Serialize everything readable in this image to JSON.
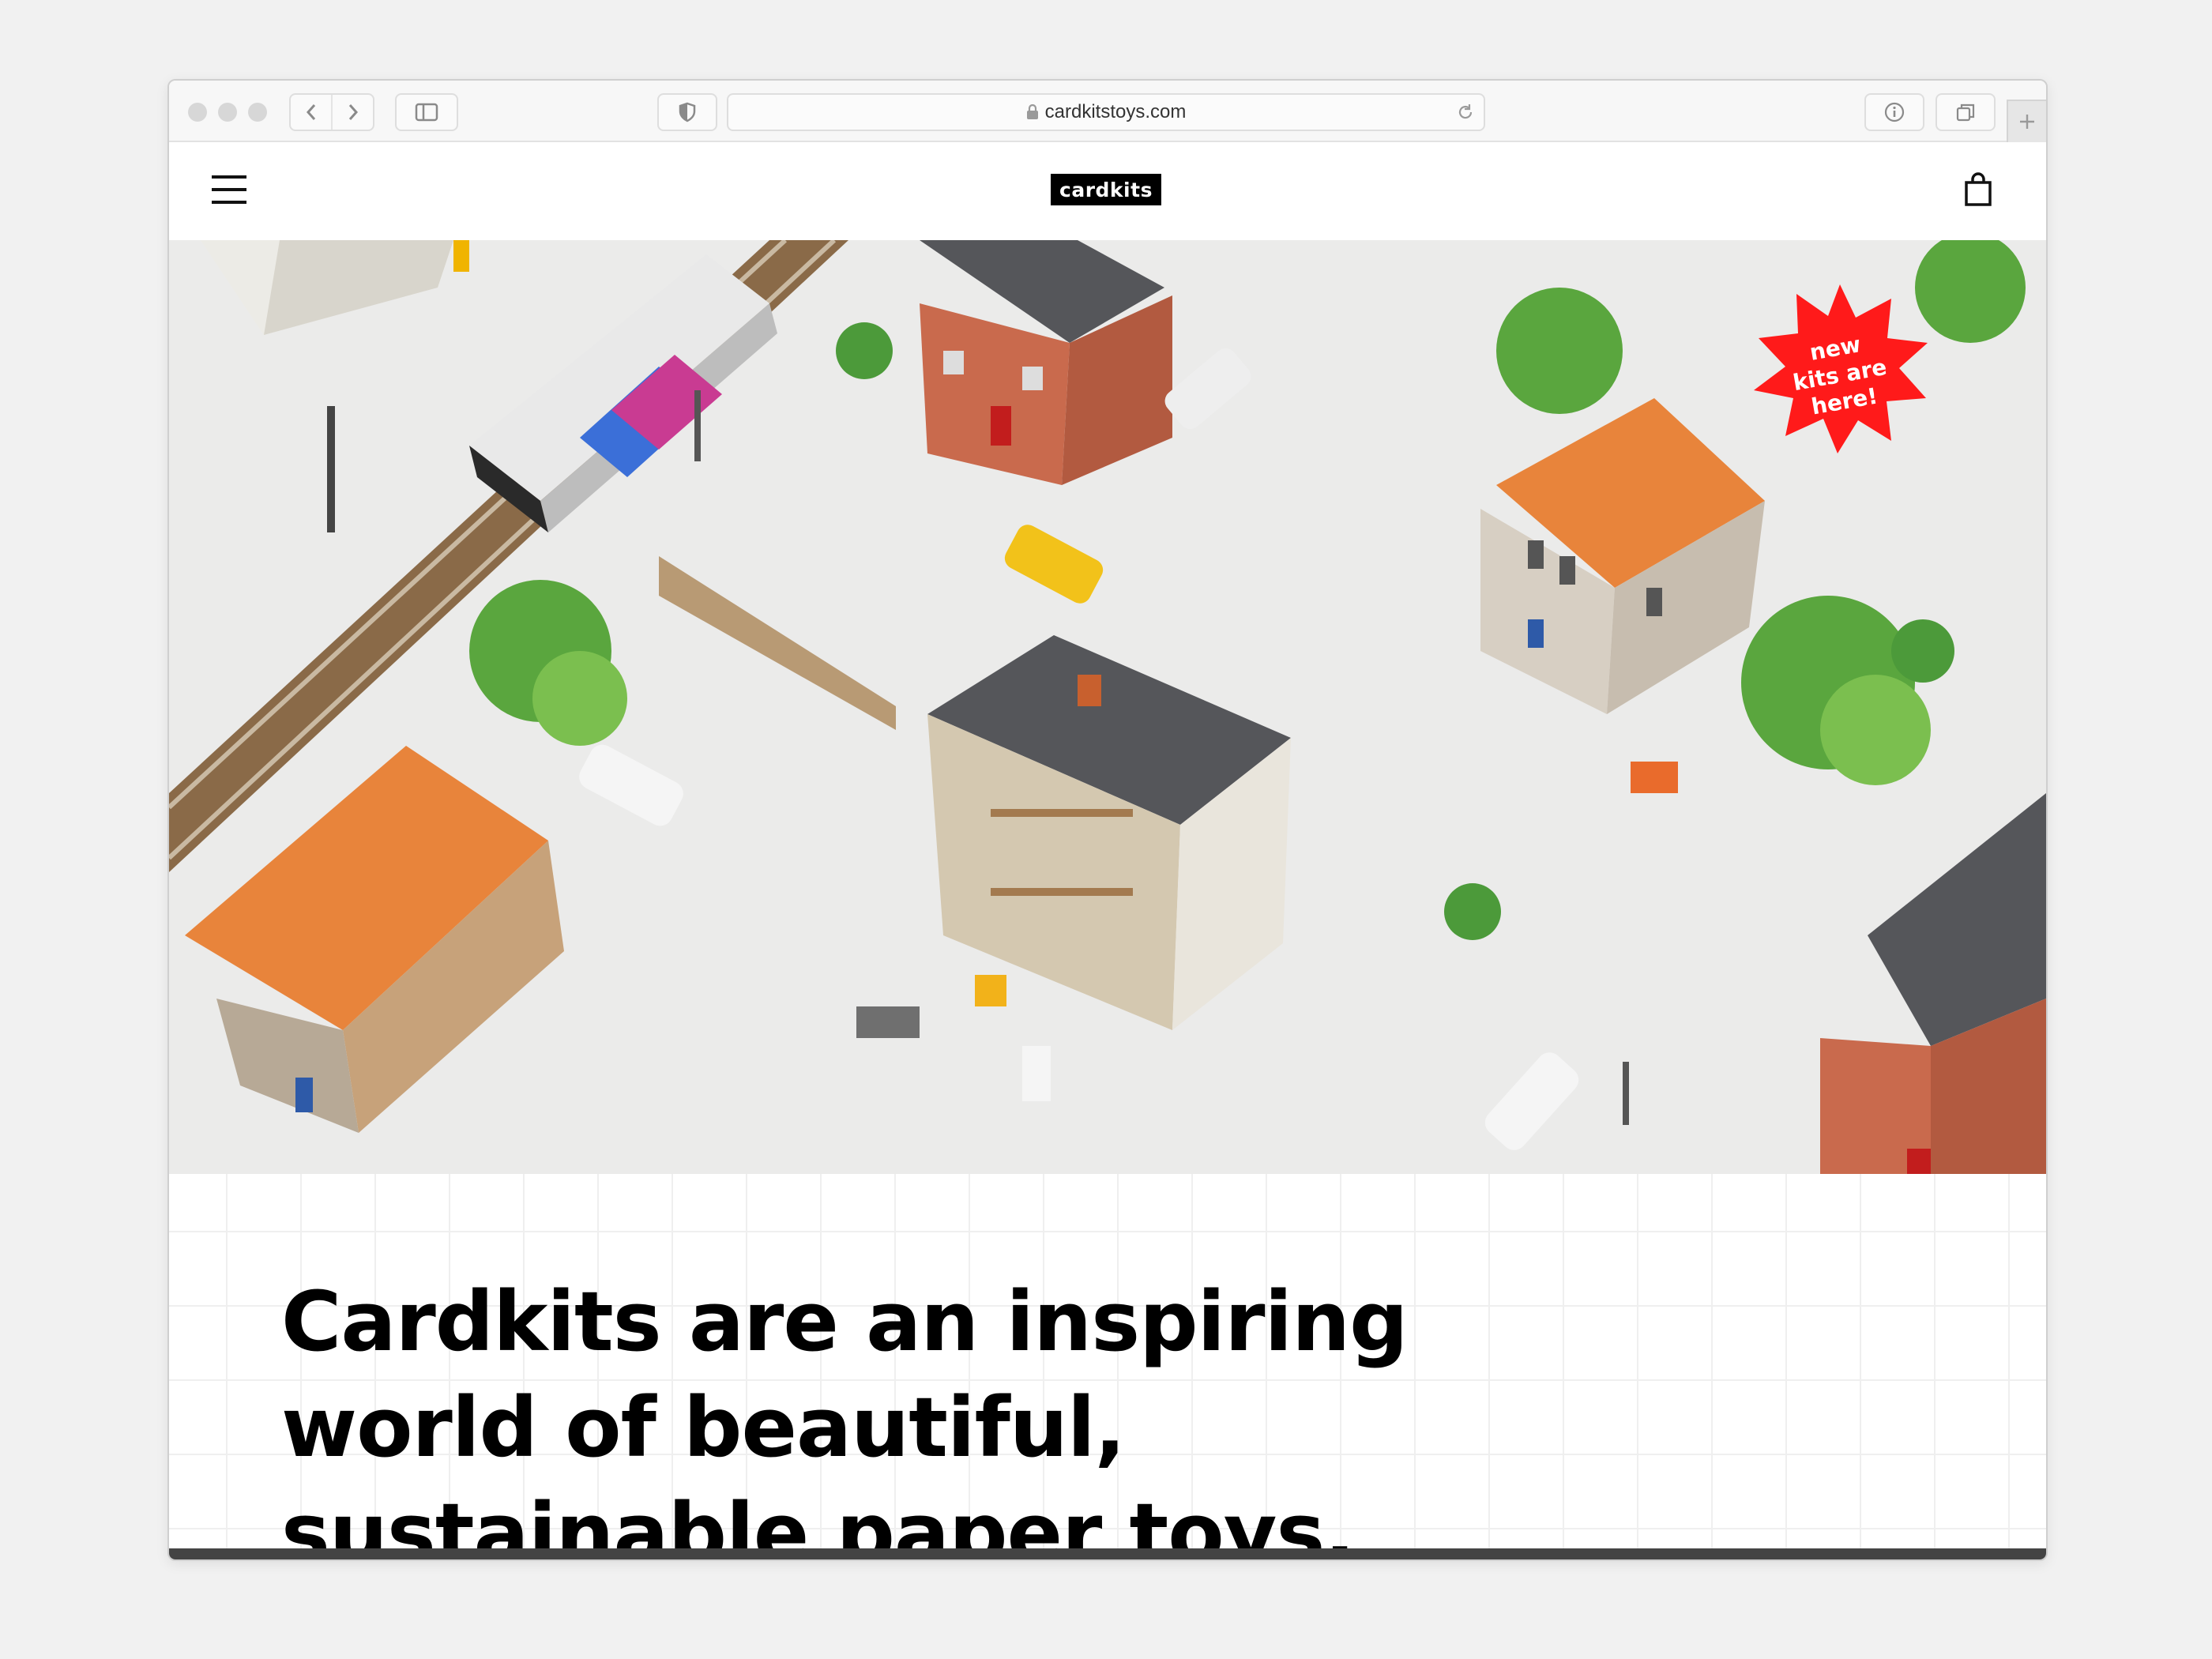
{
  "browser": {
    "url": "cardkitstoys.com",
    "icons": {
      "back": "chevron-left-icon",
      "forward": "chevron-right-icon",
      "sidebar": "sidebar-icon",
      "privacy": "shield-icon",
      "lock": "lock-icon",
      "reload": "reload-icon",
      "info": "info-icon",
      "tabs": "tabs-overview-icon",
      "new_tab": "plus-icon"
    }
  },
  "site": {
    "logo": "cardkits",
    "menu_icon": "hamburger-menu-icon",
    "cart_icon": "shopping-bag-icon"
  },
  "hero": {
    "badge_text": "new\nkits are\nhere!",
    "badge_color": "#ff1a1a"
  },
  "intro": {
    "headline": "Cardkits are an inspiring world of beautiful, sustainable paper toys."
  },
  "colors": {
    "logo_bg": "#000000",
    "roof_orange": "#e8843b",
    "roof_grey": "#55565a",
    "brick": "#c96a4d"
  }
}
